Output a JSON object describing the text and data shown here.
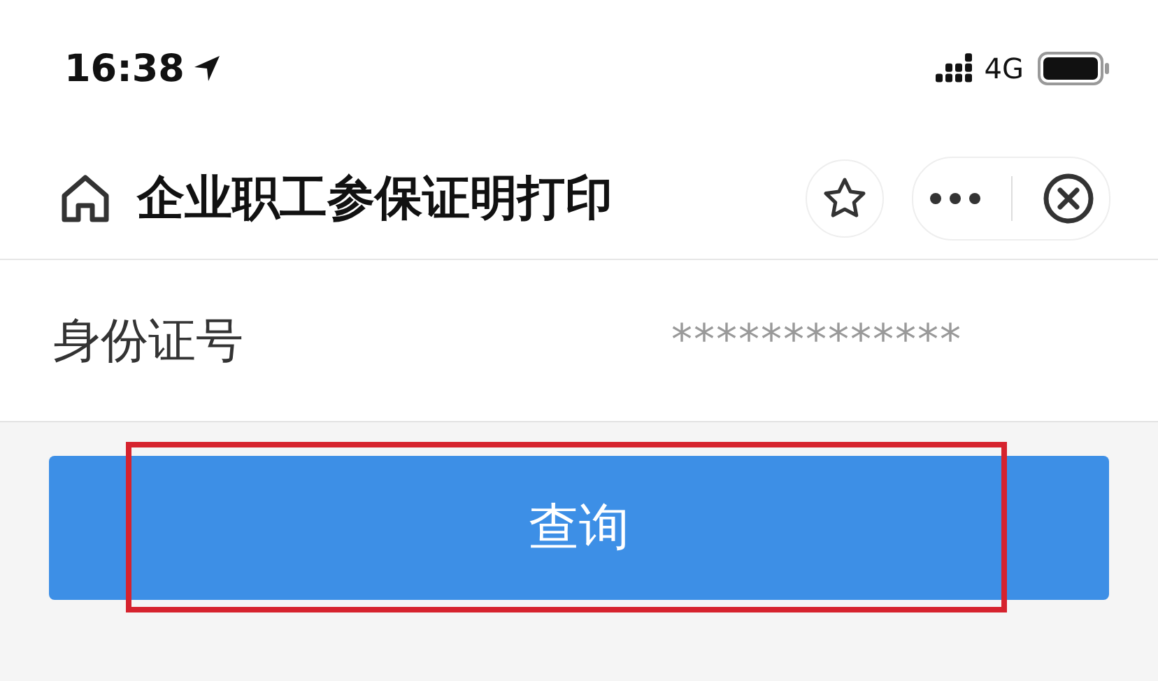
{
  "status_bar": {
    "time": "16:38",
    "network": "4G"
  },
  "nav_bar": {
    "title": "企业职工参保证明打印"
  },
  "form": {
    "fields": [
      {
        "label": "身份证号",
        "value": "*************"
      }
    ]
  },
  "query_button": {
    "label": "查询",
    "highlighted": true
  }
}
